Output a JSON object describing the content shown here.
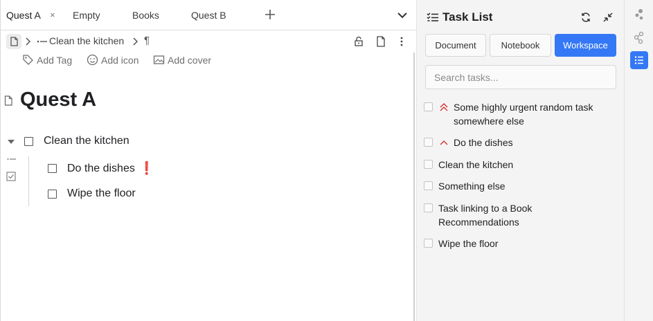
{
  "tabs": [
    {
      "label": "Quest A",
      "active": true,
      "close": "×"
    },
    {
      "label": "Empty"
    },
    {
      "label": "Books"
    },
    {
      "label": "Quest B"
    }
  ],
  "breadcrumb": {
    "items": [
      "Clean the kitchen"
    ],
    "block_marker": "¶"
  },
  "doc_meta": {
    "add_tag": "Add Tag",
    "add_icon": "Add icon",
    "add_cover": "Add cover"
  },
  "document": {
    "title": "Quest A",
    "tasks": [
      {
        "label": "Clean the kitchen",
        "checked": false,
        "children": [
          {
            "label": "Do the dishes",
            "checked": false,
            "badge": "❗"
          },
          {
            "label": "Wipe the floor",
            "checked": false
          }
        ]
      }
    ]
  },
  "task_panel": {
    "title": "Task List",
    "scopes": [
      "Document",
      "Notebook",
      "Workspace"
    ],
    "active_scope": "Workspace",
    "search_placeholder": "Search tasks...",
    "tasks": [
      {
        "line1": "Some highly urgent random task",
        "line2": "somewhere else",
        "priority": "highest"
      },
      {
        "line1": "Do the dishes",
        "priority": "high"
      },
      {
        "line1": "Clean the kitchen"
      },
      {
        "line1": "Something else"
      },
      {
        "line1": "Task linking to a Book",
        "line2": "Recommendations"
      },
      {
        "line1": "Wipe the floor"
      }
    ]
  },
  "colors": {
    "accent": "#3478f6",
    "priority_red": "#d32f2f",
    "panel_bg": "#f4f4f4"
  },
  "icons": {
    "tab_add": "plus-icon",
    "tab_more": "chevron-down-icon",
    "breadcrumb_doc": "document-icon",
    "panel": "task-list-icon",
    "refresh": "refresh-icon",
    "collapse": "collapse-icon",
    "rail": [
      "graph-dots-icon",
      "graph-icon",
      "task-list-icon"
    ]
  }
}
